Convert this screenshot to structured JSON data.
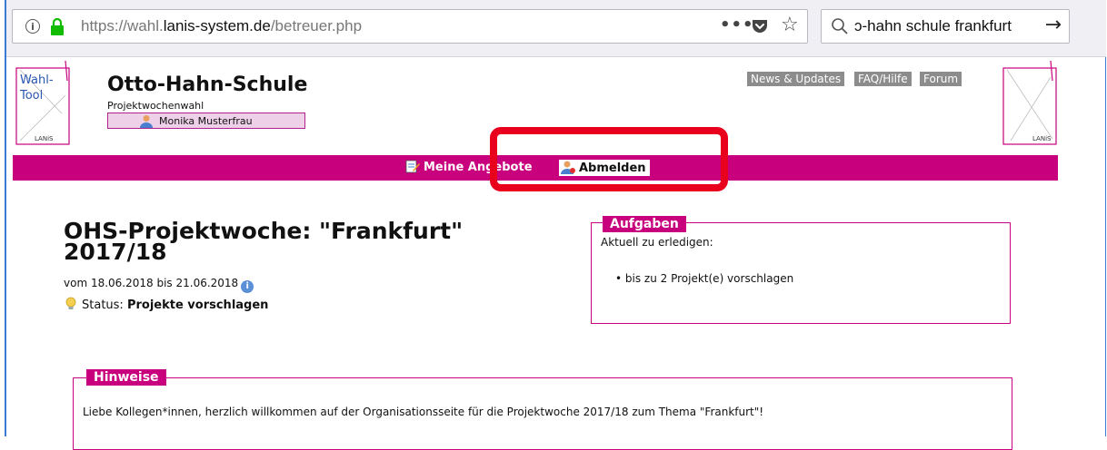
{
  "browser": {
    "url_prefix": "https://wahl.",
    "url_domain": "lanis-system.de",
    "url_path": "/betreuer.php",
    "more_label": "•••",
    "search_text": "ɔ-hahn schule frankfurt"
  },
  "logo": {
    "left_text1": "Wahl-",
    "left_text2": "Tool",
    "left_mark": "LANiS",
    "right_mark": "LANiS"
  },
  "header": {
    "school": "Otto-Hahn-Schule",
    "subtitle": "Projektwochenwahl",
    "user": "Monika Musterfrau",
    "links": [
      "News & Updates",
      "FAQ/Hilfe",
      "Forum"
    ]
  },
  "nav": {
    "offers": "Meine Angebote",
    "logout": "Abmelden"
  },
  "project": {
    "title": "OHS-Projektwoche: \"Frankfurt\" 2017/18",
    "dates": "vom 18.06.2018 bis 21.06.2018",
    "status_label": "Status:",
    "status_value": "Projekte vorschlagen"
  },
  "tasks": {
    "legend": "Aufgaben",
    "intro": "Aktuell zu erledigen:",
    "items": [
      "bis zu 2 Projekt(e) vorschlagen"
    ]
  },
  "notes": {
    "legend": "Hinweise",
    "text": "Liebe Kollegen*innen, herzlich willkommen auf der Organisationsseite für die Projektwoche 2017/18 zum Thema \"Frankfurt\"!"
  },
  "colors": {
    "brand": "#c8007d",
    "highlight": "#e8001c",
    "link_bg": "#8c8c8c"
  }
}
